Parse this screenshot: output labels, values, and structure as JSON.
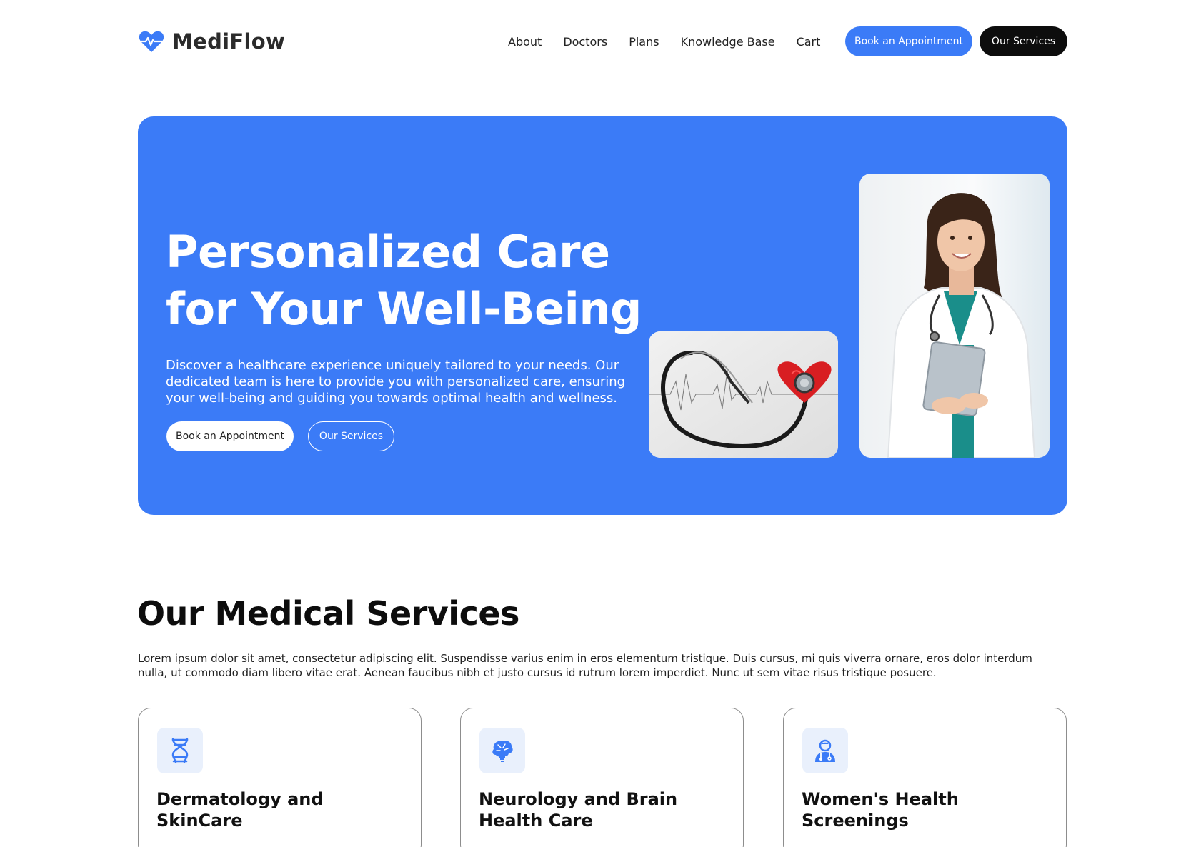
{
  "brand": {
    "name": "MediFlow",
    "accent": "#3b7bf7",
    "dark": "#0d0d0d"
  },
  "nav": {
    "items": [
      {
        "label": "About"
      },
      {
        "label": "Doctors"
      },
      {
        "label": "Plans"
      },
      {
        "label": "Knowledge Base"
      },
      {
        "label": "Cart"
      }
    ],
    "book_label": "Book an Appointment",
    "services_label": "Our Services"
  },
  "hero": {
    "title": "Personalized Care for Your Well-Being",
    "description": "Discover a healthcare experience uniquely tailored to your needs. Our dedicated team is here to provide you with personalized care, ensuring your well-being and guiding you towards optimal health and wellness.",
    "book_label": "Book an Appointment",
    "services_label": "Our Services",
    "background": "#3b7bf7"
  },
  "services": {
    "title": "Our Medical Services",
    "description": "Lorem ipsum dolor sit amet, consectetur adipiscing elit. Suspendisse varius enim in eros elementum tristique. Duis cursus, mi quis viverra ornare, eros dolor interdum nulla, ut commodo diam libero vitae erat. Aenean faucibus nibh et justo cursus id rutrum lorem imperdiet. Nunc ut sem vitae risus tristique posuere.",
    "cards": [
      {
        "title": "Dermatology and SkinCare",
        "icon": "dna-icon"
      },
      {
        "title": "Neurology and Brain Health Care",
        "icon": "brain-icon"
      },
      {
        "title": "Women's Health Screenings",
        "icon": "doctor-icon"
      }
    ]
  }
}
